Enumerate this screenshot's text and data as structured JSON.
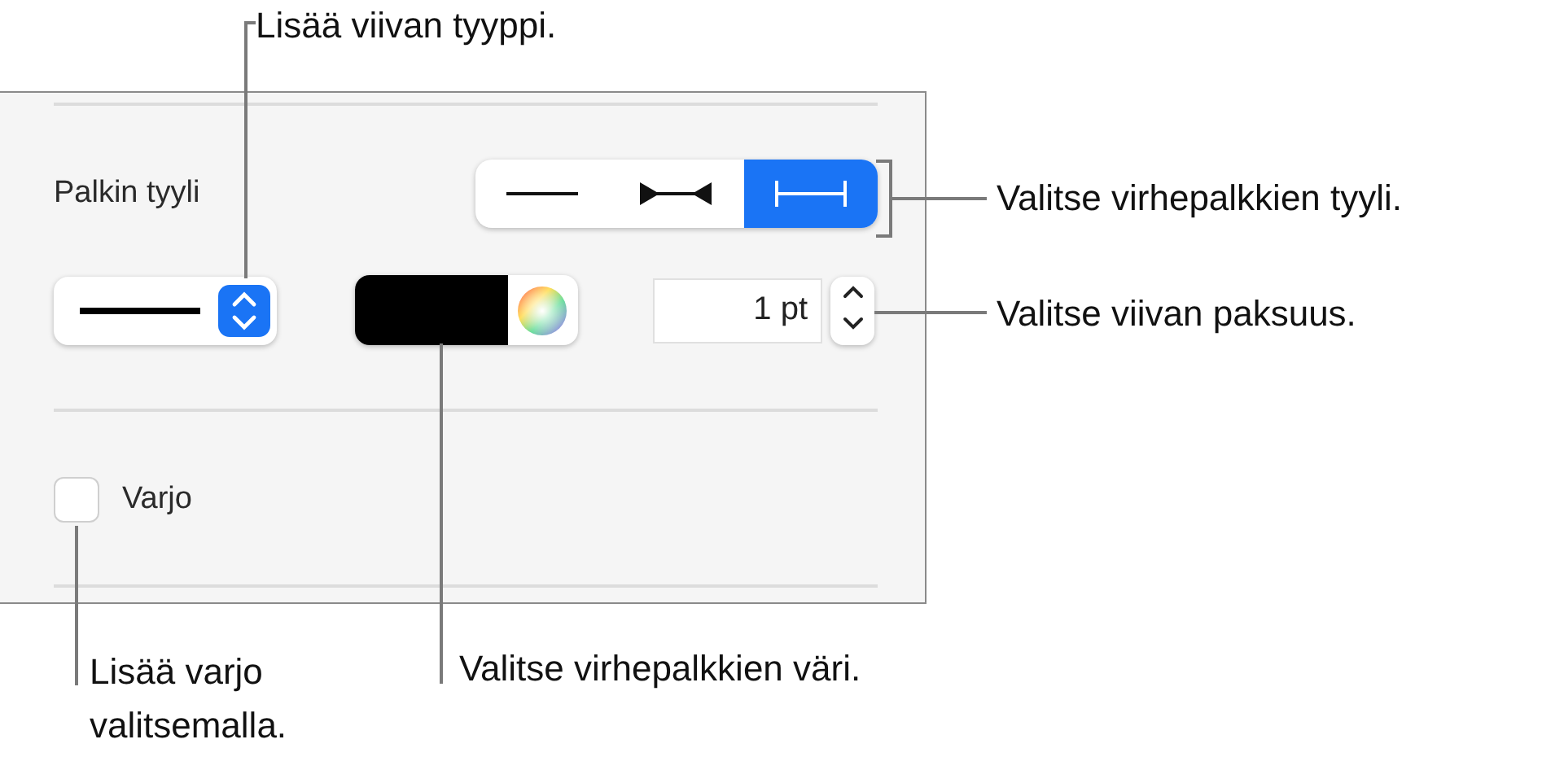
{
  "panel": {
    "bar_style": {
      "label": "Palkin tyyli",
      "segments": [
        {
          "kind": "plain",
          "selected": false
        },
        {
          "kind": "arrows",
          "selected": false
        },
        {
          "kind": "caps",
          "selected": true
        }
      ]
    },
    "line_width": {
      "value": "1 pt"
    },
    "shadow": {
      "label": "Varjo",
      "checked": false
    }
  },
  "callouts": [
    {
      "kind": "line_type",
      "text": "Lisää viivan tyyppi."
    },
    {
      "kind": "bar_style",
      "text": "Valitse virhepalkkien tyyli."
    },
    {
      "kind": "line_width",
      "text": "Valitse viivan paksuus."
    },
    {
      "kind": "shadow",
      "text": "Lisää varjo valitsemalla."
    },
    {
      "kind": "color",
      "text": "Valitse virhepalkkien väri."
    }
  ]
}
